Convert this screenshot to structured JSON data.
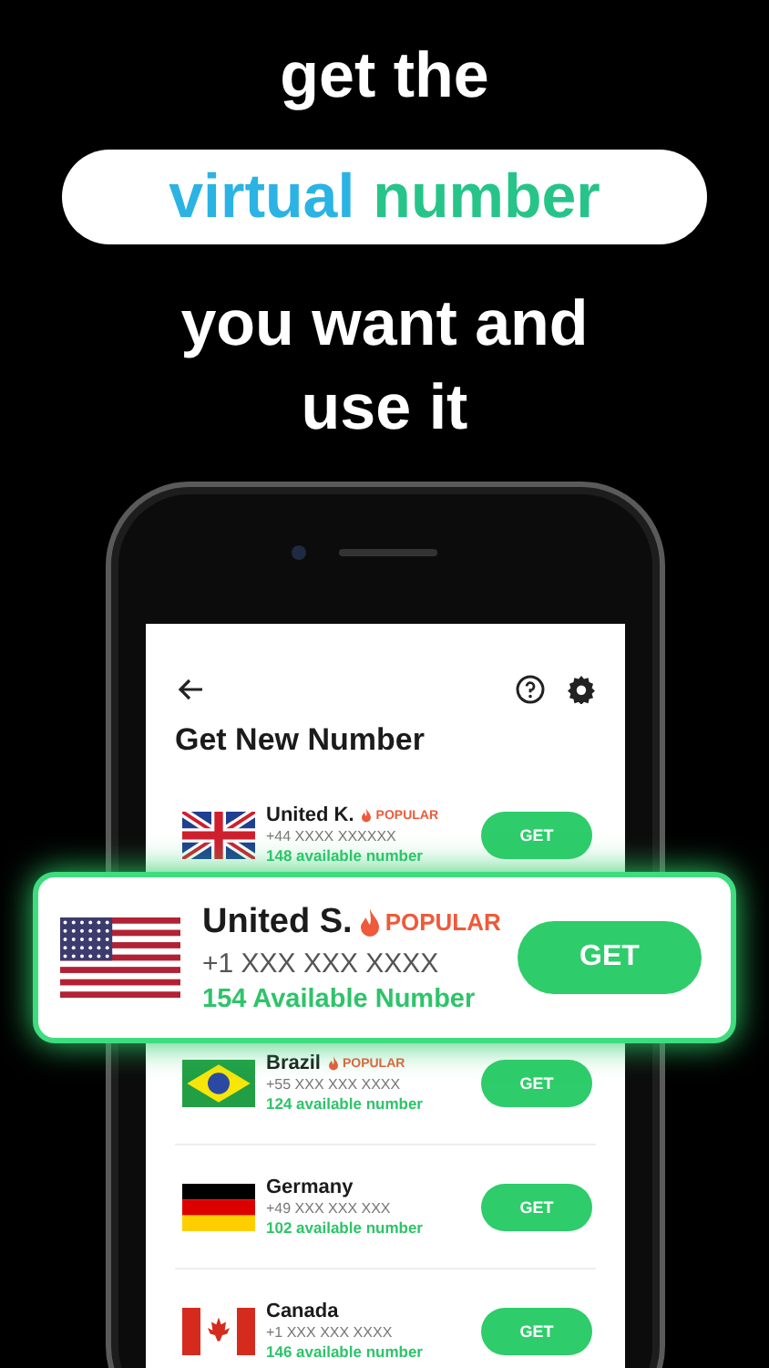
{
  "headline": {
    "line_1": "get the",
    "pill_words": [
      {
        "text": "virtual",
        "color": "#2bb3e3"
      },
      {
        "text": "number",
        "color": "#27c48a"
      }
    ],
    "line_2": "you want and",
    "line_3": "use it"
  },
  "screen": {
    "title": "Get New Number",
    "rows": [
      {
        "kind": "uk",
        "name": "United K.",
        "popular": true,
        "popular_label": "POPULAR",
        "number": "+44 XXXX XXXXXX",
        "available": "148 available number",
        "button": "GET",
        "featured": false
      },
      {
        "kind": "us",
        "name": "United S.",
        "popular": true,
        "popular_label": "POPULAR",
        "number": "+1 XXX XXX XXXX",
        "available": "154 Available Number",
        "button": "GET",
        "featured": true
      },
      {
        "kind": "br",
        "name": "Brazil",
        "popular": true,
        "popular_label": "POPULAR",
        "number": "+55 XXX XXX XXXX",
        "available": "124 available number",
        "button": "GET",
        "featured": false
      },
      {
        "kind": "de",
        "name": "Germany",
        "popular": false,
        "number": "+49 XXX XXX XXX",
        "available": "102 available number",
        "button": "GET",
        "featured": false
      },
      {
        "kind": "ca",
        "name": "Canada",
        "popular": false,
        "number": "+1 XXX XXX XXXX",
        "available": "146 available number",
        "button": "GET",
        "featured": false
      }
    ]
  }
}
